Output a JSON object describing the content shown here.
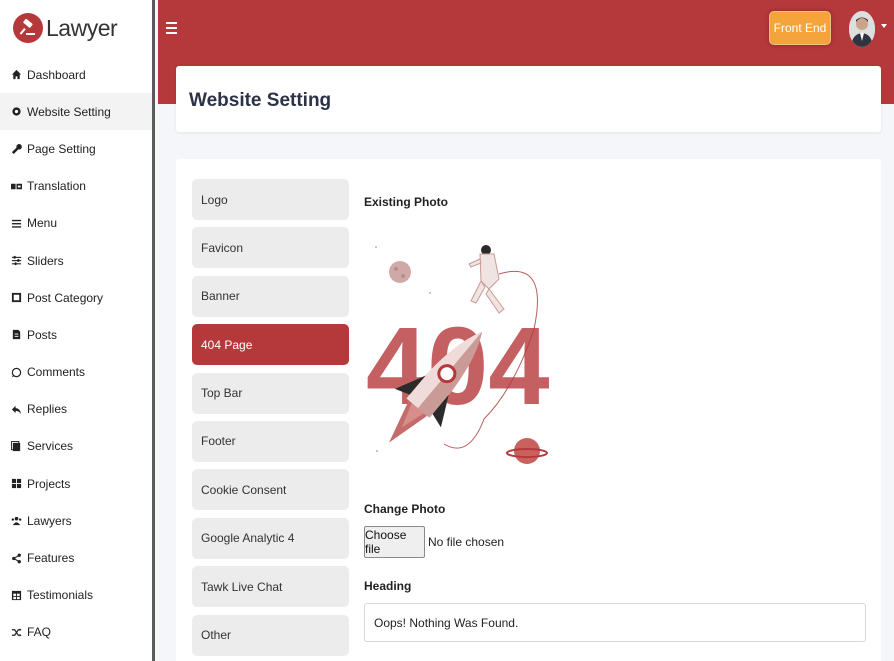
{
  "brand": {
    "name": "Lawyer"
  },
  "sidebar": {
    "items": [
      {
        "label": "Dashboard",
        "icon": "home-icon"
      },
      {
        "label": "Website Setting",
        "icon": "gear-icon"
      },
      {
        "label": "Page Setting",
        "icon": "wrench-icon"
      },
      {
        "label": "Translation",
        "icon": "translate-icon"
      },
      {
        "label": "Menu",
        "icon": "bars-icon"
      },
      {
        "label": "Sliders",
        "icon": "sliders-icon"
      },
      {
        "label": "Post Category",
        "icon": "category-icon"
      },
      {
        "label": "Posts",
        "icon": "file-icon"
      },
      {
        "label": "Comments",
        "icon": "comment-icon"
      },
      {
        "label": "Replies",
        "icon": "reply-icon"
      },
      {
        "label": "Services",
        "icon": "service-icon"
      },
      {
        "label": "Projects",
        "icon": "grid-icon"
      },
      {
        "label": "Lawyers",
        "icon": "users-icon"
      },
      {
        "label": "Features",
        "icon": "share-icon"
      },
      {
        "label": "Testimonials",
        "icon": "table-icon"
      },
      {
        "label": "FAQ",
        "icon": "shuffle-icon"
      }
    ],
    "active_index": 1
  },
  "header": {
    "front_end_label": "Front End"
  },
  "page": {
    "title": "Website Setting"
  },
  "tabs": {
    "items": [
      "Logo",
      "Favicon",
      "Banner",
      "404 Page",
      "Top Bar",
      "Footer",
      "Cookie Consent",
      "Google Analytic 4",
      "Tawk Live Chat",
      "Other"
    ],
    "active_index": 3
  },
  "form": {
    "existing_photo_label": "Existing Photo",
    "photo_text": "404",
    "change_photo_label": "Change Photo",
    "choose_file_label": "Choose file",
    "no_file_text": "No file chosen",
    "heading_label": "Heading",
    "heading_value": "Oops! Nothing Was Found."
  },
  "colors": {
    "primary": "#b5383a",
    "accent": "#f5a33b",
    "title": "#2c3248"
  }
}
